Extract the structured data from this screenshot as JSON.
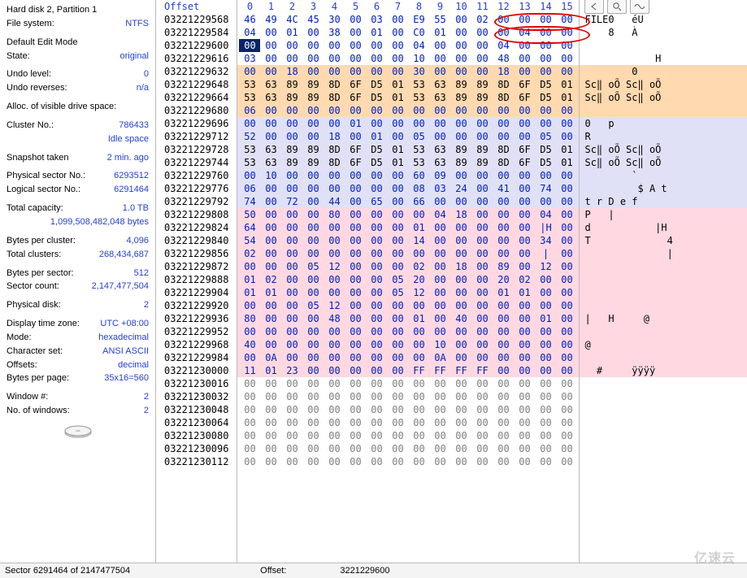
{
  "sidebar": {
    "title": "Hard disk 2, Partition 1",
    "fs_label": "File system:",
    "fs_val": "NTFS",
    "edit_mode_hdr": "Default Edit Mode",
    "state_label": "State:",
    "state_val": "original",
    "undo_level_label": "Undo level:",
    "undo_level_val": "0",
    "undo_rev_label": "Undo reverses:",
    "undo_rev_val": "n/a",
    "alloc_hdr": "Alloc. of visible drive space:",
    "cluster_label": "Cluster No.:",
    "cluster_val": "786433",
    "idle_val": "Idle space",
    "snap_label": "Snapshot taken",
    "snap_val": "2 min. ago",
    "phys_label": "Physical sector No.:",
    "phys_val": "6293512",
    "log_label": "Logical sector No.:",
    "log_val": "6291464",
    "cap_label": "Total capacity:",
    "cap_val": "1.0 TB",
    "cap_bytes": "1,099,508,482,048 bytes",
    "bpc_label": "Bytes per cluster:",
    "bpc_val": "4,096",
    "tc_label": "Total clusters:",
    "tc_val": "268,434,687",
    "bps_label": "Bytes per sector:",
    "bps_val": "512",
    "sc_label": "Sector count:",
    "sc_val": "2,147,477,504",
    "pd_label": "Physical disk:",
    "pd_val": "2",
    "dtz_label": "Display time zone:",
    "dtz_val": "UTC +08:00",
    "mode_label": "Mode:",
    "mode_val": "hexadecimal",
    "cs_label": "Character set:",
    "cs_val": "ANSI ASCII",
    "offs_label": "Offsets:",
    "offs_val": "decimal",
    "bpp_label": "Bytes per page:",
    "bpp_val": "35x16=560",
    "win_label": "Window #:",
    "win_val": "2",
    "now_label": "No. of windows:",
    "now_val": "2"
  },
  "header": {
    "offset": "Offset",
    "cols": [
      "0",
      "1",
      "2",
      "3",
      "4",
      "5",
      "6",
      "7",
      "8",
      "9",
      "10",
      "11",
      "12",
      "13",
      "14",
      "15"
    ]
  },
  "status": {
    "sector": "Sector 6291464 of 2147477504",
    "off_label": "Offset:",
    "off_val": "3221229600"
  },
  "rows": [
    {
      "off": "03221229568",
      "bg": "none",
      "fg": "bl",
      "b": [
        "46",
        "49",
        "4C",
        "45",
        "30",
        "00",
        "03",
        "00",
        "E9",
        "55",
        "00",
        "02",
        "00",
        "00",
        "00",
        "00"
      ],
      "a": "FILE0   éU"
    },
    {
      "off": "03221229584",
      "bg": "none",
      "fg": "bl",
      "b": [
        "04",
        "00",
        "01",
        "00",
        "38",
        "00",
        "01",
        "00",
        "C0",
        "01",
        "00",
        "00",
        "00",
        "04",
        "00",
        "00"
      ],
      "a": "    8   À"
    },
    {
      "off": "03221229600",
      "bg": "none",
      "fg": "bl",
      "b": [
        "00",
        "00",
        "00",
        "00",
        "00",
        "00",
        "00",
        "00",
        "04",
        "00",
        "00",
        "00",
        "04",
        "00",
        "00",
        "00"
      ],
      "a": ""
    },
    {
      "off": "03221229616",
      "bg": "none",
      "fg": "bl",
      "b": [
        "03",
        "00",
        "00",
        "00",
        "00",
        "00",
        "00",
        "00",
        "10",
        "00",
        "00",
        "00",
        "48",
        "00",
        "00",
        "00"
      ],
      "a": "            H"
    },
    {
      "off": "03221229632",
      "bg": "or",
      "fg": "bl",
      "b": [
        "00",
        "00",
        "18",
        "00",
        "00",
        "00",
        "00",
        "00",
        "30",
        "00",
        "00",
        "00",
        "18",
        "00",
        "00",
        "00"
      ],
      "a": "        0"
    },
    {
      "off": "03221229648",
      "bg": "or",
      "fg": "bk",
      "b": [
        "53",
        "63",
        "89",
        "89",
        "8D",
        "6F",
        "D5",
        "01",
        "53",
        "63",
        "89",
        "89",
        "8D",
        "6F",
        "D5",
        "01"
      ],
      "a": "Sc‖ oÕ Sc‖ oÕ"
    },
    {
      "off": "03221229664",
      "bg": "or",
      "fg": "bk",
      "b": [
        "53",
        "63",
        "89",
        "89",
        "8D",
        "6F",
        "D5",
        "01",
        "53",
        "63",
        "89",
        "89",
        "8D",
        "6F",
        "D5",
        "01"
      ],
      "a": "Sc‖ oÕ Sc‖ oÕ"
    },
    {
      "off": "03221229680",
      "bg": "or",
      "fg": "bl",
      "b": [
        "06",
        "00",
        "00",
        "00",
        "00",
        "00",
        "00",
        "00",
        "00",
        "00",
        "00",
        "00",
        "00",
        "00",
        "00",
        "00"
      ],
      "a": ""
    },
    {
      "off": "03221229696",
      "bg": "bl",
      "fg": "bl",
      "b": [
        "00",
        "00",
        "00",
        "00",
        "00",
        "01",
        "00",
        "00",
        "00",
        "00",
        "00",
        "00",
        "00",
        "00",
        "00",
        "00"
      ],
      "a": "0   p"
    },
    {
      "off": "03221229712",
      "bg": "bl",
      "fg": "bl",
      "b": [
        "52",
        "00",
        "00",
        "00",
        "18",
        "00",
        "01",
        "00",
        "05",
        "00",
        "00",
        "00",
        "00",
        "00",
        "05",
        "00"
      ],
      "a": "R"
    },
    {
      "off": "03221229728",
      "bg": "bl",
      "fg": "bk",
      "b": [
        "53",
        "63",
        "89",
        "89",
        "8D",
        "6F",
        "D5",
        "01",
        "53",
        "63",
        "89",
        "89",
        "8D",
        "6F",
        "D5",
        "01"
      ],
      "a": "Sc‖ oÕ Sc‖ oÕ"
    },
    {
      "off": "03221229744",
      "bg": "bl",
      "fg": "bk",
      "b": [
        "53",
        "63",
        "89",
        "89",
        "8D",
        "6F",
        "D5",
        "01",
        "53",
        "63",
        "89",
        "89",
        "8D",
        "6F",
        "D5",
        "01"
      ],
      "a": "Sc‖ oÕ Sc‖ oÕ"
    },
    {
      "off": "03221229760",
      "bg": "bl",
      "fg": "bl",
      "b": [
        "00",
        "10",
        "00",
        "00",
        "00",
        "00",
        "00",
        "00",
        "60",
        "09",
        "00",
        "00",
        "00",
        "00",
        "00",
        "00"
      ],
      "a": "        `"
    },
    {
      "off": "03221229776",
      "bg": "bl",
      "fg": "bl",
      "b": [
        "06",
        "00",
        "00",
        "00",
        "00",
        "00",
        "00",
        "00",
        "08",
        "03",
        "24",
        "00",
        "41",
        "00",
        "74",
        "00"
      ],
      "a": "         $ A t"
    },
    {
      "off": "03221229792",
      "bg": "bl",
      "fg": "bl",
      "b": [
        "74",
        "00",
        "72",
        "00",
        "44",
        "00",
        "65",
        "00",
        "66",
        "00",
        "00",
        "00",
        "00",
        "00",
        "00",
        "00"
      ],
      "a": "t r D e f"
    },
    {
      "off": "03221229808",
      "bg": "pk",
      "fg": "bl",
      "b": [
        "50",
        "00",
        "00",
        "00",
        "80",
        "00",
        "00",
        "00",
        "00",
        "04",
        "18",
        "00",
        "00",
        "00",
        "04",
        "00"
      ],
      "a": "P   |"
    },
    {
      "off": "03221229824",
      "bg": "pk",
      "fg": "bl",
      "b": [
        "64",
        "00",
        "00",
        "00",
        "00",
        "00",
        "00",
        "00",
        "01",
        "00",
        "00",
        "00",
        "00",
        "00",
        "|H",
        "00"
      ],
      "a": "d           |H"
    },
    {
      "off": "03221229840",
      "bg": "pk",
      "fg": "bl",
      "b": [
        "54",
        "00",
        "00",
        "00",
        "00",
        "00",
        "00",
        "00",
        "14",
        "00",
        "00",
        "00",
        "00",
        "00",
        "34",
        "00"
      ],
      "a": "T             4"
    },
    {
      "off": "03221229856",
      "bg": "pk",
      "fg": "bl",
      "b": [
        "02",
        "00",
        "00",
        "00",
        "00",
        "00",
        "00",
        "00",
        "00",
        "00",
        "00",
        "00",
        "00",
        "00",
        "|",
        "00"
      ],
      "a": "              |"
    },
    {
      "off": "03221229872",
      "bg": "pk",
      "fg": "bl",
      "b": [
        "00",
        "00",
        "00",
        "05",
        "12",
        "00",
        "00",
        "00",
        "02",
        "00",
        "18",
        "00",
        "89",
        "00",
        "12",
        "00"
      ],
      "a": ""
    },
    {
      "off": "03221229888",
      "bg": "pk",
      "fg": "bl",
      "b": [
        "01",
        "02",
        "00",
        "00",
        "00",
        "00",
        "00",
        "05",
        "20",
        "00",
        "00",
        "00",
        "20",
        "02",
        "00",
        "00"
      ],
      "a": ""
    },
    {
      "off": "03221229904",
      "bg": "pk",
      "fg": "bl",
      "b": [
        "01",
        "01",
        "00",
        "00",
        "00",
        "00",
        "00",
        "05",
        "12",
        "00",
        "00",
        "00",
        "01",
        "01",
        "00",
        "00"
      ],
      "a": ""
    },
    {
      "off": "03221229920",
      "bg": "pk",
      "fg": "bl",
      "b": [
        "00",
        "00",
        "00",
        "05",
        "12",
        "00",
        "00",
        "00",
        "00",
        "00",
        "00",
        "00",
        "00",
        "00",
        "00",
        "00"
      ],
      "a": ""
    },
    {
      "off": "03221229936",
      "bg": "pk",
      "fg": "bl",
      "b": [
        "80",
        "00",
        "00",
        "00",
        "48",
        "00",
        "00",
        "00",
        "01",
        "00",
        "40",
        "00",
        "00",
        "00",
        "01",
        "00"
      ],
      "a": "|   H     @"
    },
    {
      "off": "03221229952",
      "bg": "pk",
      "fg": "bl",
      "b": [
        "00",
        "00",
        "00",
        "00",
        "00",
        "00",
        "00",
        "00",
        "00",
        "00",
        "00",
        "00",
        "00",
        "00",
        "00",
        "00"
      ],
      "a": ""
    },
    {
      "off": "03221229968",
      "bg": "pk",
      "fg": "bl",
      "b": [
        "40",
        "00",
        "00",
        "00",
        "00",
        "00",
        "00",
        "00",
        "00",
        "10",
        "00",
        "00",
        "00",
        "00",
        "00",
        "00"
      ],
      "a": "@"
    },
    {
      "off": "03221229984",
      "bg": "pk",
      "fg": "bl",
      "b": [
        "00",
        "0A",
        "00",
        "00",
        "00",
        "00",
        "00",
        "00",
        "00",
        "0A",
        "00",
        "00",
        "00",
        "00",
        "00",
        "00"
      ],
      "a": ""
    },
    {
      "off": "03221230000",
      "bg": "pk",
      "fg": "bl",
      "b": [
        "11",
        "01",
        "23",
        "00",
        "00",
        "00",
        "00",
        "00",
        "FF",
        "FF",
        "FF",
        "FF",
        "00",
        "00",
        "00",
        "00"
      ],
      "a": "  #     ÿÿÿÿ"
    },
    {
      "off": "03221230016",
      "bg": "none",
      "fg": "gr",
      "b": [
        "00",
        "00",
        "00",
        "00",
        "00",
        "00",
        "00",
        "00",
        "00",
        "00",
        "00",
        "00",
        "00",
        "00",
        "00",
        "00"
      ],
      "a": ""
    },
    {
      "off": "03221230032",
      "bg": "none",
      "fg": "gr",
      "b": [
        "00",
        "00",
        "00",
        "00",
        "00",
        "00",
        "00",
        "00",
        "00",
        "00",
        "00",
        "00",
        "00",
        "00",
        "00",
        "00"
      ],
      "a": ""
    },
    {
      "off": "03221230048",
      "bg": "none",
      "fg": "gr",
      "b": [
        "00",
        "00",
        "00",
        "00",
        "00",
        "00",
        "00",
        "00",
        "00",
        "00",
        "00",
        "00",
        "00",
        "00",
        "00",
        "00"
      ],
      "a": ""
    },
    {
      "off": "03221230064",
      "bg": "none",
      "fg": "gr",
      "b": [
        "00",
        "00",
        "00",
        "00",
        "00",
        "00",
        "00",
        "00",
        "00",
        "00",
        "00",
        "00",
        "00",
        "00",
        "00",
        "00"
      ],
      "a": ""
    },
    {
      "off": "03221230080",
      "bg": "none",
      "fg": "gr",
      "b": [
        "00",
        "00",
        "00",
        "00",
        "00",
        "00",
        "00",
        "00",
        "00",
        "00",
        "00",
        "00",
        "00",
        "00",
        "00",
        "00"
      ],
      "a": ""
    },
    {
      "off": "03221230096",
      "bg": "none",
      "fg": "gr",
      "b": [
        "00",
        "00",
        "00",
        "00",
        "00",
        "00",
        "00",
        "00",
        "00",
        "00",
        "00",
        "00",
        "00",
        "00",
        "00",
        "00"
      ],
      "a": ""
    },
    {
      "off": "03221230112",
      "bg": "none",
      "fg": "gr",
      "b": [
        "00",
        "00",
        "00",
        "00",
        "00",
        "00",
        "00",
        "00",
        "00",
        "00",
        "00",
        "00",
        "00",
        "00",
        "00",
        "00"
      ],
      "a": ""
    }
  ],
  "watermark": "亿速云"
}
